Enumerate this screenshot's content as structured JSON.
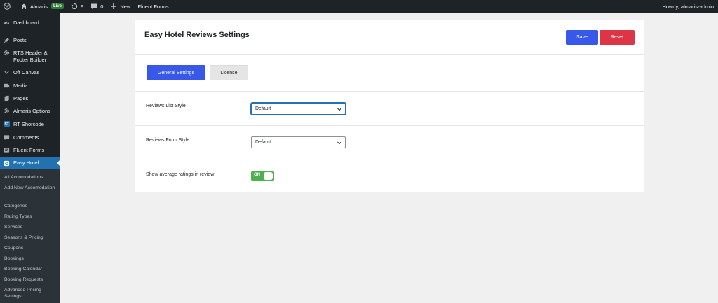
{
  "adminbar": {
    "site_name": "Almaris",
    "live_badge": "Live",
    "updates_count": "9",
    "comments_count": "0",
    "new_label": "New",
    "fluent_forms_label": "Fluent Forms",
    "howdy": "Howdy, almaris-admin"
  },
  "sidebar": {
    "items": [
      {
        "label": "Dashboard",
        "icon": "dashboard-icon"
      },
      {
        "label": "Posts",
        "icon": "pin-icon"
      },
      {
        "label": "RTS Header & Footer Builder",
        "icon": "gear-icon"
      },
      {
        "label": "Off Canvas",
        "icon": "chevron-down-icon"
      },
      {
        "label": "Media",
        "icon": "media-icon"
      },
      {
        "label": "Pages",
        "icon": "pages-icon"
      },
      {
        "label": "Almaris Options",
        "icon": "gear-icon"
      },
      {
        "label": "RT Shorcode",
        "icon": "rt-badge-icon"
      },
      {
        "label": "Comments",
        "icon": "comment-icon"
      },
      {
        "label": "Fluent Forms",
        "icon": "form-icon"
      },
      {
        "label": "Easy Hotel",
        "icon": "hotel-icon"
      }
    ],
    "rt_badge_text": "RT",
    "submenu": [
      "All Accomodations",
      "Add New Accomodation",
      "Categories",
      "Rating Types",
      "Services",
      "Seasons & Pricing",
      "Coupons",
      "Bookings",
      "Booking Calendar",
      "Booking Requests",
      "Advanced Pricing Settings"
    ]
  },
  "settings": {
    "title": "Easy Hotel Reviews Settings",
    "save_label": "Save",
    "reset_label": "Reset",
    "tabs": [
      "General Settings",
      "License"
    ],
    "rows": [
      {
        "label": "Reviews List Style",
        "value": "Default"
      },
      {
        "label": "Reviews Form Style",
        "value": "Default"
      },
      {
        "label": "Show average ratings in review",
        "toggle": "ON"
      }
    ]
  },
  "colors": {
    "primary": "#3858e9",
    "danger": "#dc3545",
    "toggle_on": "#4caf50",
    "admin_bar": "#1d2327",
    "active_menu": "#2271b1"
  }
}
